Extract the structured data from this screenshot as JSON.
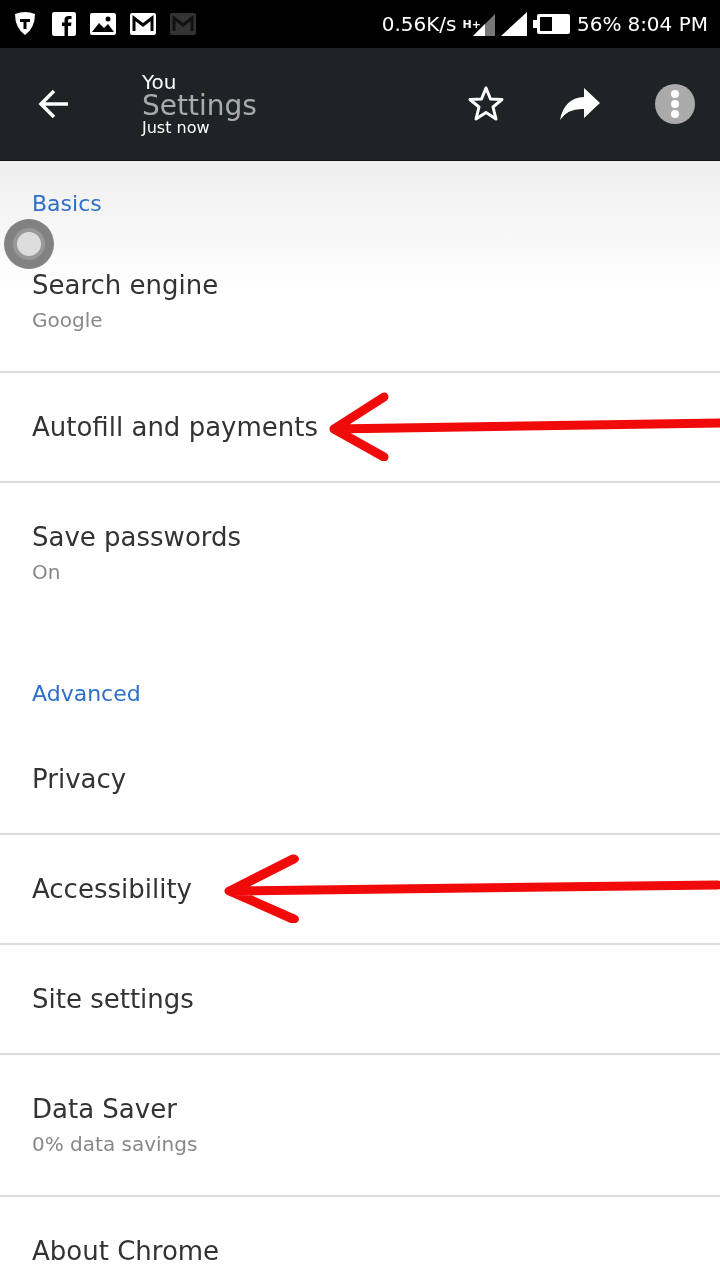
{
  "status_bar": {
    "speed": "0.56K/s",
    "network_type": "H+",
    "battery": "56%",
    "time": "8:04 PM"
  },
  "toolbar": {
    "account": "You",
    "title": "Settings",
    "subtitle": "Just now"
  },
  "sections": [
    {
      "header": "Basics",
      "items": [
        {
          "title": "Search engine",
          "subtitle": "Google",
          "annotated": false
        },
        {
          "title": "Autofill and payments",
          "annotated": true
        },
        {
          "title": "Save passwords",
          "subtitle": "On",
          "annotated": false
        }
      ]
    },
    {
      "header": "Advanced",
      "items": [
        {
          "title": "Privacy",
          "annotated": false
        },
        {
          "title": "Accessibility",
          "annotated": true
        },
        {
          "title": "Site settings",
          "annotated": false
        },
        {
          "title": "Data Saver",
          "subtitle": "0% data savings",
          "annotated": false
        },
        {
          "title": "About Chrome",
          "annotated": false
        }
      ]
    }
  ]
}
